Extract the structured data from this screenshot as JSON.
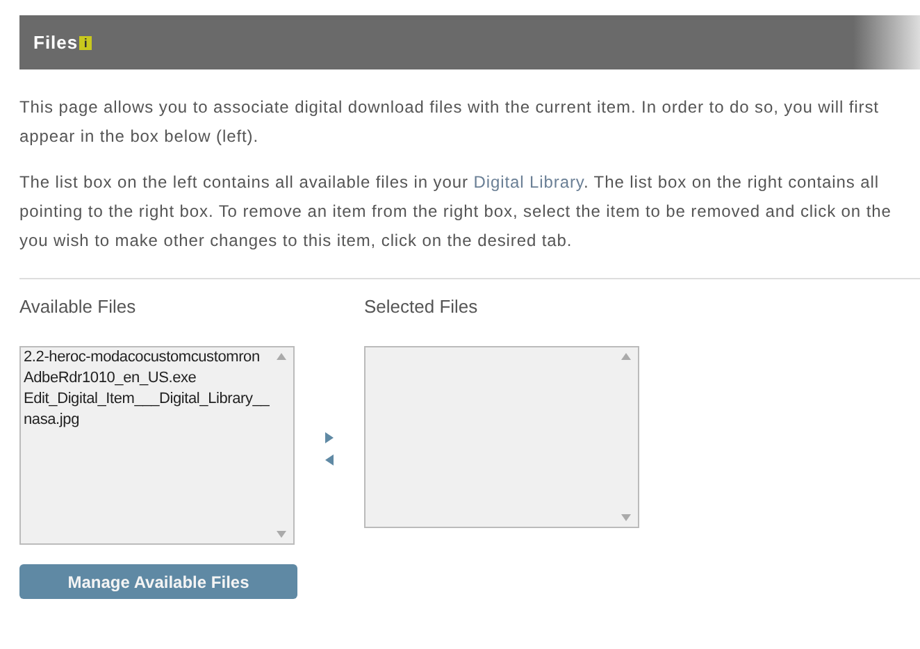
{
  "header": {
    "title": "Files",
    "info_icon": "i"
  },
  "intro_lines": [
    {
      "text": "This page allows you to associate digital download files with the current item. In order to do so, you will first"
    },
    {
      "text": "appear in the box below (left)."
    }
  ],
  "detail_lines": [
    {
      "text": "The list box on the left contains all available files in your ",
      "link": "Digital Library",
      "rest": ". The list box on the right contains all"
    },
    {
      "text": "pointing to the right box. To remove an item from the right box, select the item to be removed and click on the"
    },
    {
      "text": "you wish to make other changes to this item, click on the desired tab."
    }
  ],
  "available": {
    "label": "Available Files",
    "items": [
      "2.2-heroc-modacocustomcustomron",
      "AdbeRdr1010_en_US.exe",
      "Edit_Digital_Item___Digital_Library__",
      "nasa.jpg"
    ]
  },
  "selected": {
    "label": "Selected Files"
  },
  "manage_button": "Manage Available Files"
}
